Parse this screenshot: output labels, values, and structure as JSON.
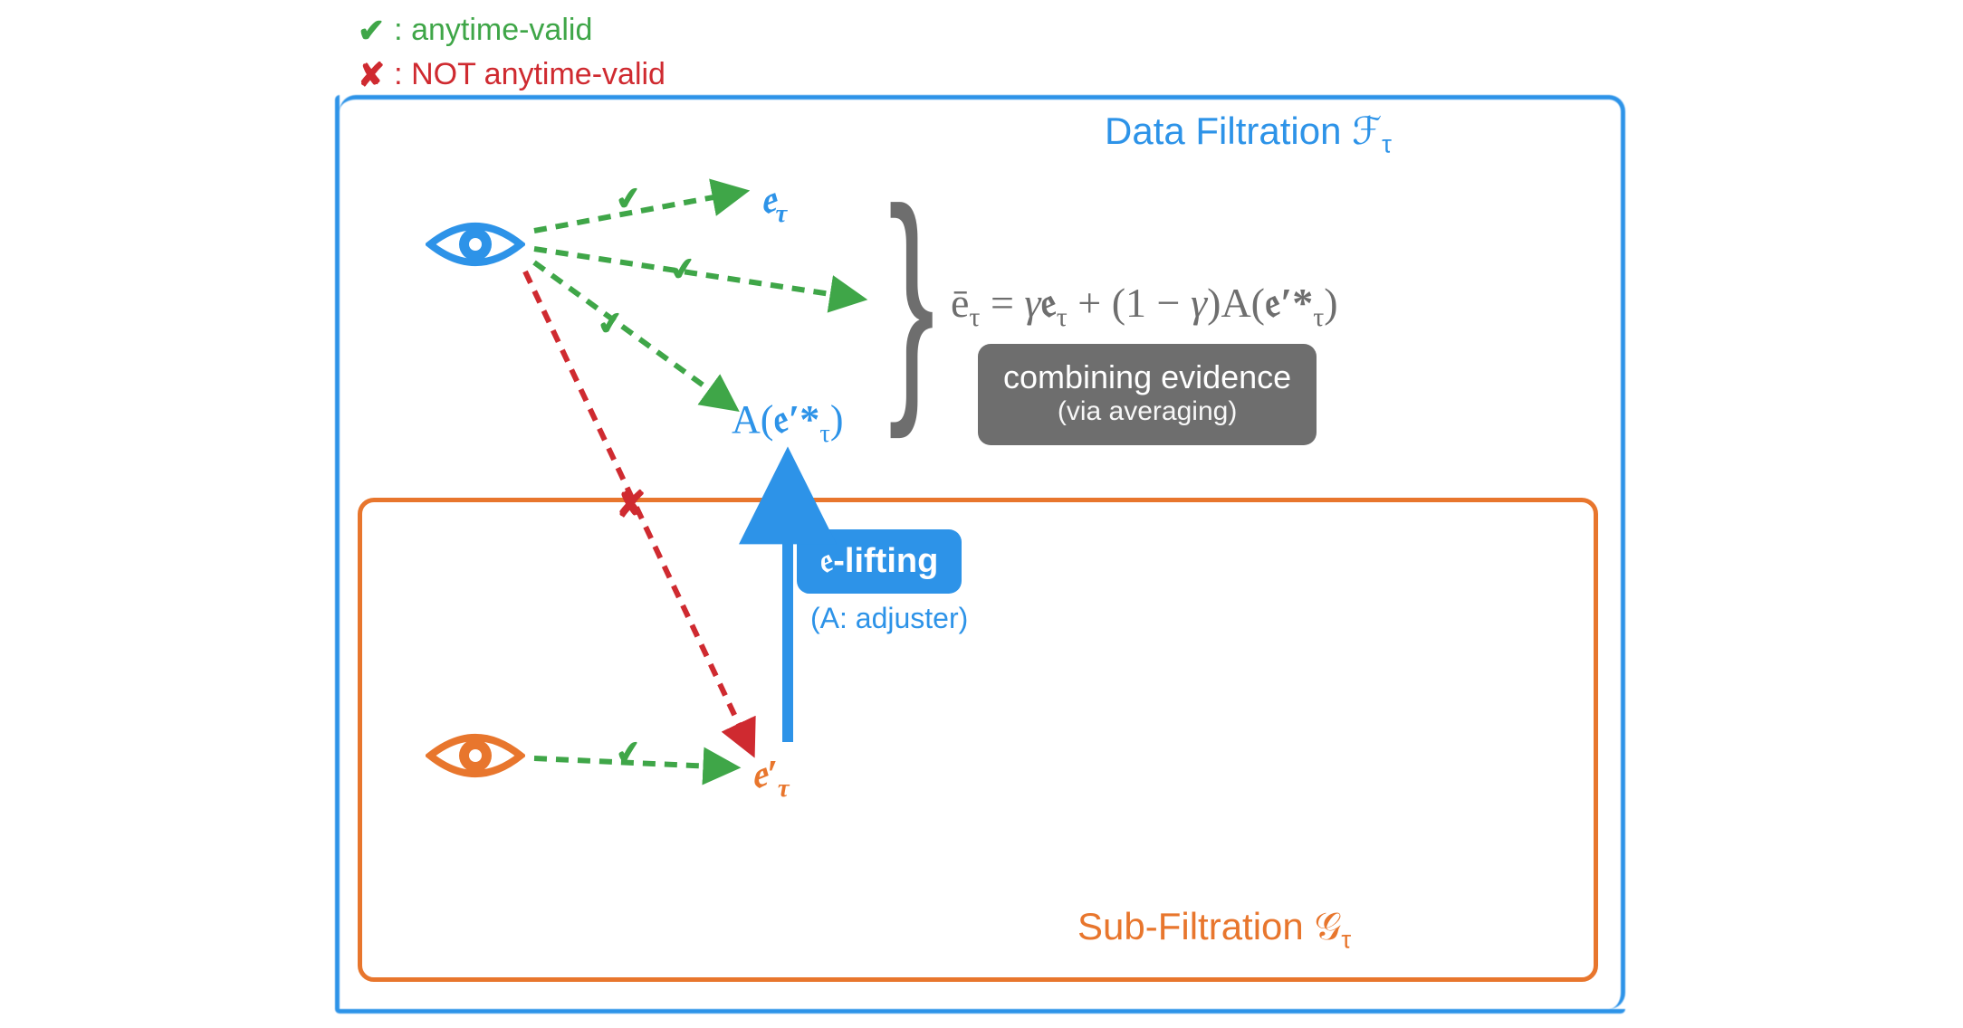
{
  "legend": {
    "valid_label": ": anytime-valid",
    "not_valid_label": ": NOT anytime-valid"
  },
  "boxes": {
    "outer_title_prefix": "Data Filtration ",
    "outer_symbol": "ℱ",
    "inner_title_prefix": "Sub-Filtration ",
    "inner_symbol": "𝒢",
    "tau": "τ"
  },
  "nodes": {
    "e_tau": "𝔢",
    "e_tau_sub": "τ",
    "a_e_tau": "A(𝔢′*",
    "a_e_tau_sub": "τ",
    "a_e_tau_close": ")",
    "e_tau_prime": "𝔢′",
    "e_tau_prime_sub": "τ"
  },
  "formula": {
    "text": "ē_τ = γ𝔢_τ + (1 − γ)A(𝔢′*_τ)",
    "display_lhs": "ē",
    "display_sub": "τ",
    "eq": " = γ",
    "e1": "𝔢",
    "plus": " + (1 − γ)A(",
    "e2": "𝔢′*",
    "close": ")"
  },
  "gray_badge": {
    "line1": "combining evidence",
    "line2": "(via averaging)"
  },
  "blue_badge": {
    "label": "𝔢-lifting",
    "sub": "(A: adjuster)"
  },
  "colors": {
    "blue": "#2d93e8",
    "orange": "#e8762d",
    "green": "#3fa648",
    "red": "#cf2a30",
    "gray": "#6e6e6e"
  }
}
